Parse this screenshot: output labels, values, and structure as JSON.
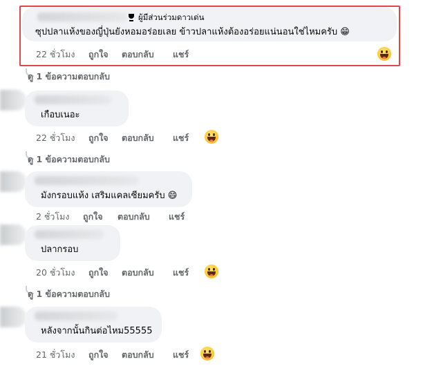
{
  "top_comment": {
    "badge": "ผู้มีส่วนร่วมดาวเด่น",
    "text": "ซุปปลาแห้งของญี่ปุ่นยังหอมอร่อยเลย ข้าวปลาแห้งต้องอร่อยแน่นอนใช่ไหมครับ 😁",
    "time": "22 ชั่วโมง",
    "like": "ถูกใจ",
    "reply": "ตอบกลับ",
    "share": "แชร์",
    "reaction_icon": "grinning-squint-emoji",
    "highlight_color": "#e0474c"
  },
  "comments": [
    {
      "replies_link": "ดู 1 ข้อความตอบกลับ",
      "text": "เกือบเนอะ",
      "time": "22 ชั่วโมง",
      "like": "ถูกใจ",
      "reply": "ตอบกลับ",
      "share": "แชร์",
      "reaction_icon": "grinning-squint-emoji"
    },
    {
      "replies_link": "ดู 1 ข้อความตอบกลับ",
      "text": "มังกรอบแห้ง เสริมแคลเซียมครับ 😄",
      "time": "2 ชั่วโมง",
      "like": "ถูกใจ",
      "reply": "ตอบกลับ",
      "share": "แชร์"
    },
    {
      "text": "ปลากรอบ",
      "time": "20 ชั่วโมง",
      "like": "ถูกใจ",
      "reply": "ตอบกลับ",
      "share": "แชร์",
      "reaction_icon": "grinning-squint-emoji"
    },
    {
      "replies_link": "ดู 1 ข้อความตอบกลับ",
      "text": "หลังจากนั้นกินต่อไหม55555",
      "time": "21 ชั่วโมง",
      "like": "ถูกใจ",
      "reply": "ตอบกลับ",
      "share": "แชร์",
      "reaction_icon": "grinning-squint-emoji"
    }
  ],
  "colors": {
    "bubble": "#f0f2f5",
    "meta_text": "#65676b",
    "text": "#050505"
  }
}
